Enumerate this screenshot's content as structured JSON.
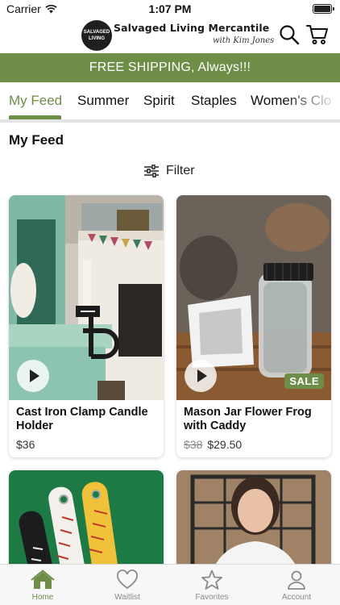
{
  "status_bar": {
    "carrier": "Carrier",
    "time": "1:07 PM"
  },
  "header": {
    "badge_line1": "SALVAGED",
    "badge_line2": "LIVING",
    "title": "Salvaged Living Mercantile",
    "subtitle": "with Kim Jones",
    "search_icon": "search-icon",
    "cart_icon": "cart-icon"
  },
  "promo": {
    "text": "FREE SHIPPING, Always!!!"
  },
  "category_tabs": [
    {
      "label": "My Feed",
      "active": true
    },
    {
      "label": "Summer"
    },
    {
      "label": "Spirit"
    },
    {
      "label": "Staples"
    },
    {
      "label": "Women's Clo"
    }
  ],
  "feed": {
    "title": "My Feed",
    "filter_label": "Filter"
  },
  "products": [
    {
      "name": "Cast Iron Clamp Candle Holder",
      "price": "$36",
      "has_video": true
    },
    {
      "name": "Mason Jar Flower Frog with Caddy",
      "original_price": "$38",
      "price": "$29.50",
      "badge": "SALE",
      "has_video": true
    },
    {
      "name": "",
      "price": ""
    },
    {
      "name": "",
      "price": ""
    }
  ],
  "bottom_nav": [
    {
      "label": "Home",
      "icon": "home-icon",
      "active": true
    },
    {
      "label": "Waitlist",
      "icon": "heart-icon"
    },
    {
      "label": "Favorites",
      "icon": "star-icon"
    },
    {
      "label": "Account",
      "icon": "user-icon"
    }
  ],
  "colors": {
    "brand_green": "#6e8e48",
    "divider": "#e4e4e4"
  }
}
